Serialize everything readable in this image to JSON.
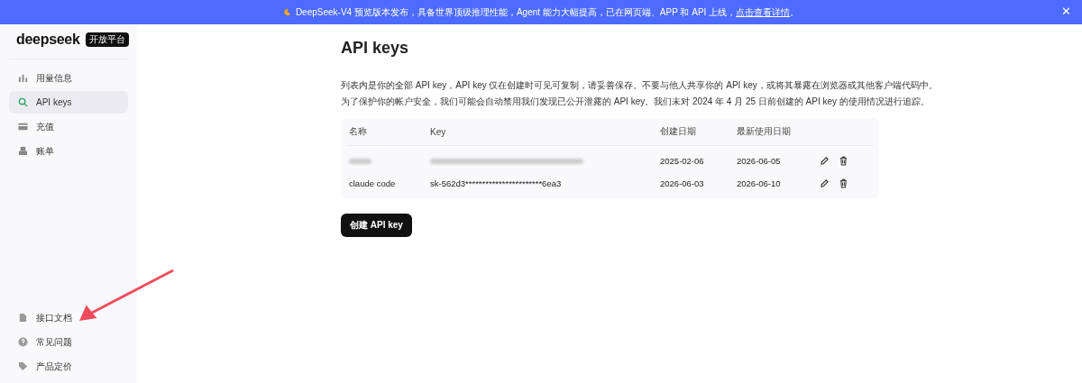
{
  "banner": {
    "text": "DeepSeek-V4 预览版本发布，具备世界顶级推理性能，Agent 能力大幅提高，已在网页端、APP 和 API 上线，",
    "link": "点击查看详情",
    "end": "。",
    "close": "✕"
  },
  "sidebar": {
    "logo": "deepseek",
    "badge": "开放平台",
    "items": [
      {
        "label": "用量信息",
        "selected": false
      },
      {
        "label": "API keys",
        "selected": true
      },
      {
        "label": "充值",
        "selected": false
      },
      {
        "label": "账单",
        "selected": false
      }
    ],
    "bottom_items": [
      {
        "label": "接口文档",
        "selected": false
      },
      {
        "label": "常见问题",
        "selected": false
      },
      {
        "label": "产品定价",
        "selected": false
      }
    ]
  },
  "page": {
    "title": "API keys",
    "description": [
      "列表内是你的全部 API key，API key 仅在创建时可见可复制，请妥善保存。不要与他人共享你的 API key，或将其暴露在浏览器或其他客户端代码中。",
      "为了保护你的帐户安全，我们可能会自动禁用我们发现已公开泄露的 API key。我们未对 2024 年 4 月 25 日前创建的 API key 的使用情况进行追踪。"
    ],
    "table": {
      "columns": [
        "名称",
        "Key",
        "创建日期",
        "最新使用日期"
      ],
      "rows": [
        {
          "redacted": true,
          "created": "2025-02-06",
          "last_used": "2026-06-05"
        },
        {
          "redacted": false,
          "name": "claude code",
          "key": "sk-562d3***********************6ea3",
          "created": "2026-06-03",
          "last_used": "2026-06-10"
        }
      ]
    },
    "create_button": "创建 API key"
  }
}
